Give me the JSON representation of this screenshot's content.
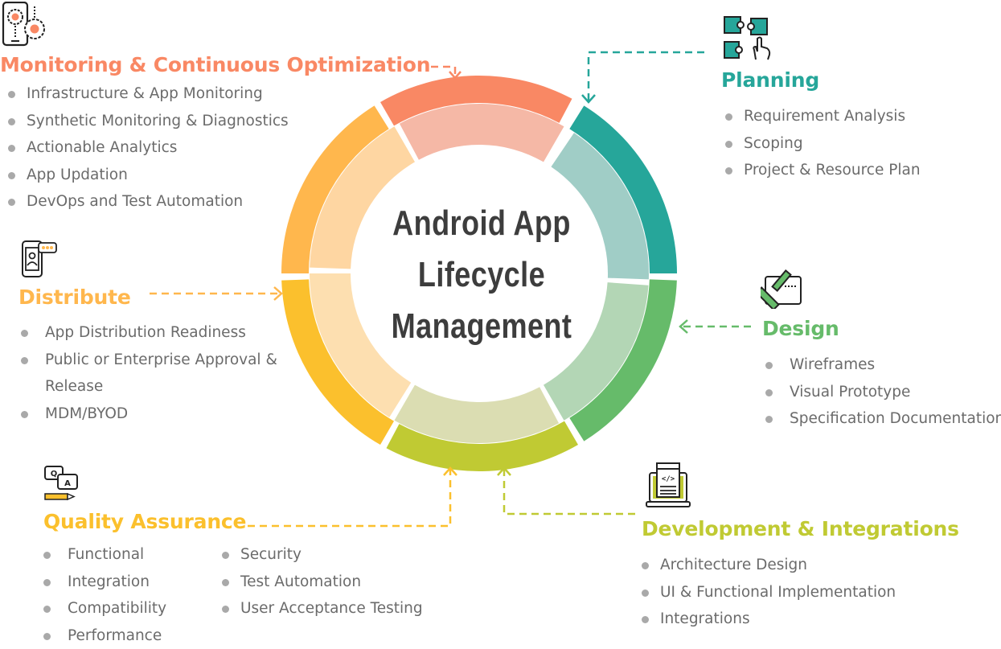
{
  "center": {
    "line1": "Android App",
    "line2": "Lifecycle",
    "line3": "Management"
  },
  "colors": {
    "monitoring": "#f98864",
    "planning": "#26a69a",
    "design": "#66bb6a",
    "development": "#c0ca33",
    "quality": "#fbc02d",
    "distribute": "#ffb74d",
    "bullet": "#a9a9a9",
    "text": "#6b6b6b",
    "center_text": "#3d3d3d"
  },
  "stages": {
    "monitoring": {
      "title": "Monitoring & Continuous Optimization",
      "icon": "mobile-gears-icon",
      "items": [
        "Infrastructure & App Monitoring",
        "Synthetic Monitoring & Diagnostics",
        "Actionable Analytics",
        "App Updation",
        "DevOps and Test Automation"
      ]
    },
    "planning": {
      "title": "Planning",
      "icon": "puzzle-hand-icon",
      "items": [
        "Requirement Analysis",
        "Scoping",
        "Project & Resource Plan"
      ]
    },
    "design": {
      "title": "Design",
      "icon": "ruler-pencil-icon",
      "items": [
        "Wireframes",
        "Visual Prototype",
        "Specification Documentation"
      ]
    },
    "development": {
      "title": "Development & Integrations",
      "icon": "laptop-code-icon",
      "items": [
        "Architecture Design",
        "UI & Functional Implementation",
        "Integrations"
      ]
    },
    "quality": {
      "title": "Quality Assurance",
      "icon": "qa-chat-pencil-icon",
      "items_col1": [
        "Functional",
        "Integration",
        "Compatibility",
        "Performance"
      ],
      "items_col2": [
        "Security",
        "Test Automation",
        "User Acceptance Testing"
      ]
    },
    "distribute": {
      "title": "Distribute",
      "icon": "mobile-user-chat-icon",
      "items": [
        "App Distribution Readiness",
        "Public or Enterprise Approval & Release",
        "MDM/BYOD"
      ]
    }
  }
}
